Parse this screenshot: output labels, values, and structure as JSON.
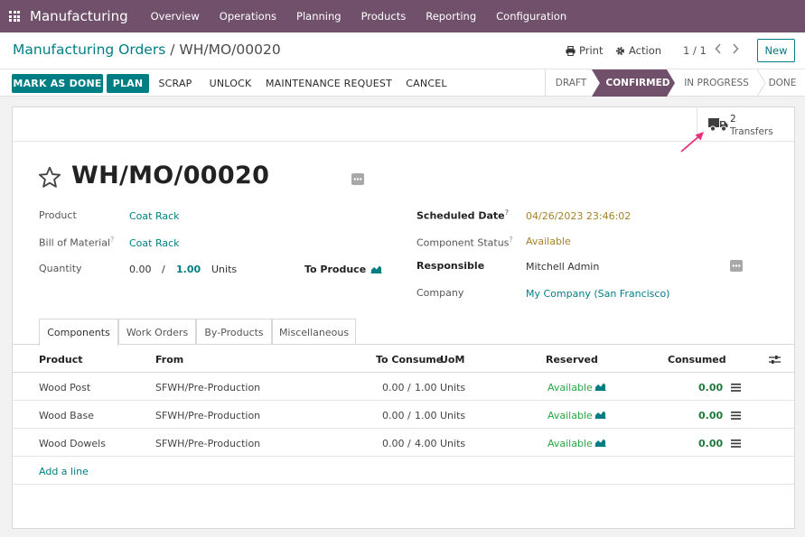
{
  "navbar": {
    "app_name": "Manufacturing",
    "menu": [
      "Overview",
      "Operations",
      "Planning",
      "Products",
      "Reporting",
      "Configuration"
    ]
  },
  "breadcrumb": {
    "parent": "Manufacturing Orders",
    "separator": "/",
    "current": "WH/MO/00020"
  },
  "control": {
    "print_label": "Print",
    "action_label": "Action",
    "pager": "1 / 1",
    "new_label": "New"
  },
  "actions": {
    "mark_as_done": "MARK AS DONE",
    "plan": "PLAN",
    "scrap": "SCRAP",
    "unlock": "UNLOCK",
    "maintenance_request": "MAINTENANCE REQUEST",
    "cancel": "CANCEL"
  },
  "stages": {
    "items": [
      "DRAFT",
      "CONFIRMED",
      "IN PROGRESS",
      "DONE"
    ],
    "active": "CONFIRMED"
  },
  "smart_button": {
    "value": "2",
    "label": "Transfers"
  },
  "form": {
    "title": "WH/MO/00020",
    "product_label": "Product",
    "product_value": "Coat Rack",
    "bom_label": "Bill of Material",
    "bom_help": "?",
    "bom_value": "Coat Rack",
    "quantity_label": "Quantity",
    "quantity_current": "0.00",
    "quantity_sep": "/",
    "quantity_total": "1.00",
    "quantity_unit": "Units",
    "to_produce_label": "To Produce",
    "scheduled_label": "Scheduled Date",
    "scheduled_help": "?",
    "scheduled_value": "04/26/2023 23:46:02",
    "component_status_label": "Component Status",
    "component_status_help": "?",
    "component_status_value": "Available",
    "responsible_label": "Responsible",
    "responsible_value": "Mitchell Admin",
    "company_label": "Company",
    "company_value": "My Company (San Francisco)"
  },
  "tabs": [
    "Components",
    "Work Orders",
    "By-Products",
    "Miscellaneous"
  ],
  "table": {
    "headers": {
      "product": "Product",
      "from": "From",
      "to_consume": "To Consume",
      "uom": "UoM",
      "reserved": "Reserved",
      "consumed": "Consumed"
    },
    "rows": [
      {
        "product": "Wood Post",
        "from": "SFWH/Pre-Production",
        "qty": "0.00 /",
        "total": "1.00",
        "uom": "Units",
        "reserved": "Available",
        "consumed": "0.00"
      },
      {
        "product": "Wood Base",
        "from": "SFWH/Pre-Production",
        "qty": "0.00 /",
        "total": "1.00",
        "uom": "Units",
        "reserved": "Available",
        "consumed": "0.00"
      },
      {
        "product": "Wood Dowels",
        "from": "SFWH/Pre-Production",
        "qty": "0.00 /",
        "total": "4.00",
        "uom": "Units",
        "reserved": "Available",
        "consumed": "0.00"
      }
    ],
    "add_line": "Add a line"
  },
  "colors": {
    "navbar": "#71506b",
    "primary": "#017e84",
    "stage_active": "#71506b",
    "available_green": "#28a745",
    "date_amber": "#a6802b",
    "arrow_pink": "#e8317a"
  },
  "icons": {
    "apps": "apps-grid-icon",
    "print": "printer-icon",
    "action": "gear-icon",
    "truck": "truck-icon",
    "star": "star-icon",
    "chart": "area-chart-icon",
    "detail": "list-detail-icon",
    "settings": "column-settings-icon"
  }
}
